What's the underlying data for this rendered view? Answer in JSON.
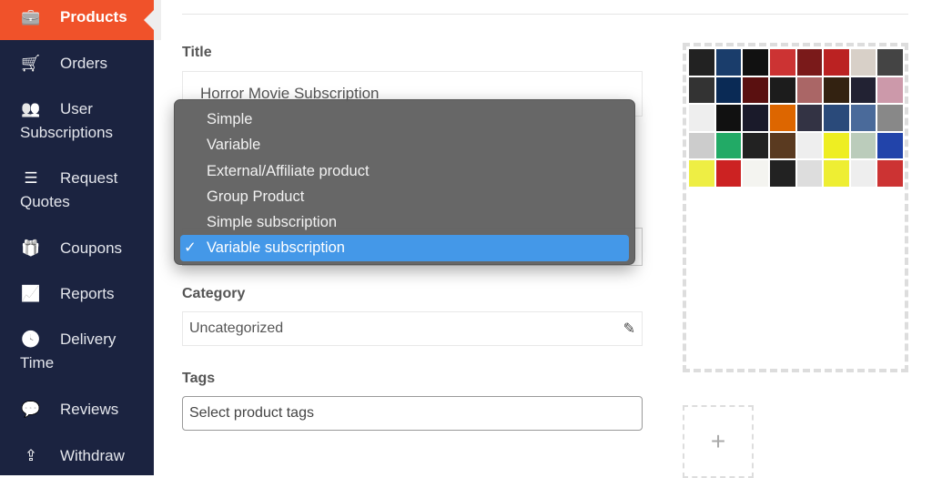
{
  "sidebar": {
    "items": [
      {
        "label": "Products",
        "icon": "briefcase-icon",
        "glyph": "💼",
        "active": true
      },
      {
        "label": "Orders",
        "icon": "cart-icon",
        "glyph": "🛒"
      },
      {
        "label": "User",
        "label2": "Subscriptions",
        "icon": "users-icon",
        "glyph": "👥"
      },
      {
        "label": "Request",
        "label2": "Quotes",
        "icon": "list-icon",
        "glyph": "☰"
      },
      {
        "label": "Coupons",
        "icon": "gift-icon",
        "glyph": "🎁"
      },
      {
        "label": "Reports",
        "icon": "chart-icon",
        "glyph": "📈"
      },
      {
        "label": "Delivery",
        "label2": "Time",
        "icon": "clock-icon",
        "glyph": "🕓"
      },
      {
        "label": "Reviews",
        "icon": "comments-icon",
        "glyph": "💬"
      },
      {
        "label": "Withdraw",
        "icon": "upload-icon",
        "glyph": "⇪"
      }
    ]
  },
  "form": {
    "title_label": "Title",
    "title_value": "Horror Movie Subscription",
    "product_type_options": [
      "Simple",
      "Variable",
      "External/Affiliate product",
      "Group Product",
      "Simple subscription",
      "Variable subscription"
    ],
    "product_type_selected": "Variable subscription",
    "category_label": "Category",
    "category_value": "Uncategorized",
    "tags_label": "Tags",
    "tags_placeholder": "Select product tags"
  },
  "image": {
    "add_label": "+"
  },
  "colors": {
    "sidebar": "#1b2340",
    "accent": "#f0522a",
    "selected": "#4498e8"
  }
}
